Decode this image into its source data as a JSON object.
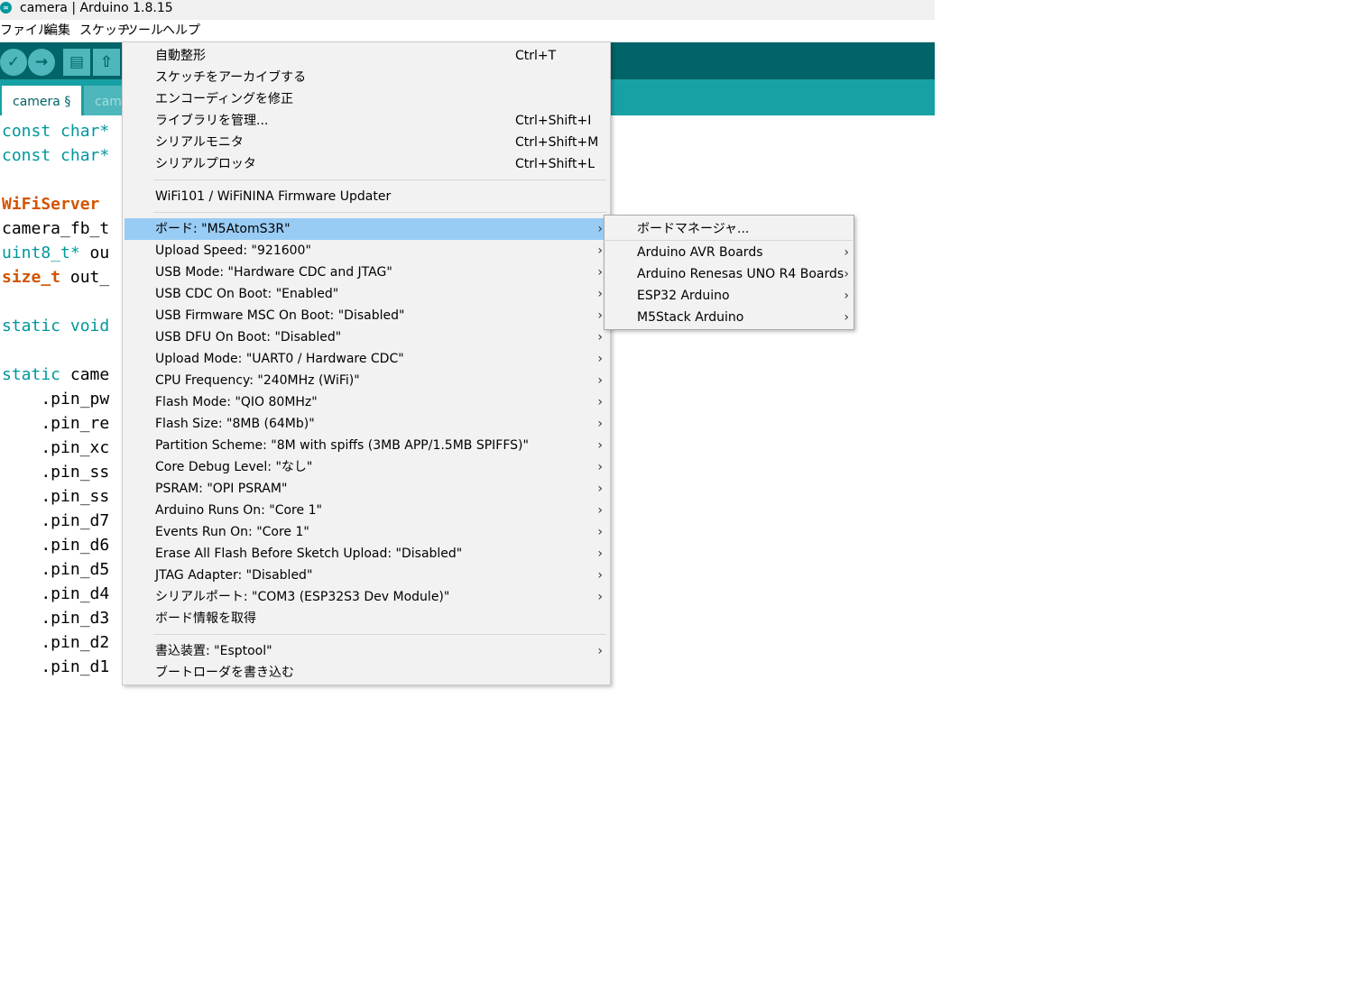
{
  "window": {
    "title": "camera | Arduino 1.8.15",
    "app_icon": "arduino-infinity-icon",
    "app_icon_glyph": "∞"
  },
  "menubar": [
    "ファイル",
    "編集",
    "スケッチ",
    "ツール",
    "ヘルプ"
  ],
  "toolbar": {
    "verify_icon": "✓",
    "upload_icon": "→",
    "new_icon": "▤",
    "open_icon": "⇧"
  },
  "tabs": [
    "camera §",
    "cam"
  ],
  "code": [
    {
      "parts": [
        {
          "t": "const char*",
          "c": "kw"
        }
      ]
    },
    {
      "parts": [
        {
          "t": "const char*",
          "c": "kw"
        }
      ]
    },
    {
      "parts": []
    },
    {
      "parts": [
        {
          "t": "WiFiServer",
          "c": "type"
        }
      ]
    },
    {
      "parts": [
        {
          "t": "camera_fb_t",
          "c": "plain"
        }
      ]
    },
    {
      "parts": [
        {
          "t": "uint8_t*",
          "c": "kw"
        },
        {
          "t": " ou",
          "c": "plain"
        }
      ]
    },
    {
      "parts": [
        {
          "t": "size_t",
          "c": "type"
        },
        {
          "t": " out_",
          "c": "plain"
        }
      ]
    },
    {
      "parts": []
    },
    {
      "parts": [
        {
          "t": "static void",
          "c": "kw"
        }
      ]
    },
    {
      "parts": []
    },
    {
      "parts": [
        {
          "t": "static",
          "c": "kw"
        },
        {
          "t": " came",
          "c": "plain"
        }
      ]
    },
    {
      "parts": [
        {
          "t": "    .pin_pw",
          "c": "plain"
        }
      ]
    },
    {
      "parts": [
        {
          "t": "    .pin_re",
          "c": "plain"
        }
      ]
    },
    {
      "parts": [
        {
          "t": "    .pin_xc",
          "c": "plain"
        }
      ]
    },
    {
      "parts": [
        {
          "t": "    .pin_ss",
          "c": "plain"
        }
      ]
    },
    {
      "parts": [
        {
          "t": "    .pin_ss",
          "c": "plain"
        }
      ]
    },
    {
      "parts": [
        {
          "t": "    .pin_d7",
          "c": "plain"
        }
      ]
    },
    {
      "parts": [
        {
          "t": "    .pin_d6",
          "c": "plain"
        }
      ]
    },
    {
      "parts": [
        {
          "t": "    .pin_d5",
          "c": "plain"
        }
      ]
    },
    {
      "parts": [
        {
          "t": "    .pin_d4",
          "c": "plain"
        }
      ]
    },
    {
      "parts": [
        {
          "t": "    .pin_d3",
          "c": "plain"
        }
      ]
    },
    {
      "parts": [
        {
          "t": "    .pin_d2",
          "c": "plain"
        }
      ]
    },
    {
      "parts": [
        {
          "t": "    .pin_d1",
          "c": "plain"
        }
      ]
    }
  ],
  "tools_menu": [
    {
      "label": "自動整形",
      "shortcut": "Ctrl+T"
    },
    {
      "label": "スケッチをアーカイブする"
    },
    {
      "label": "エンコーディングを修正"
    },
    {
      "label": "ライブラリを管理...",
      "shortcut": "Ctrl+Shift+I"
    },
    {
      "label": "シリアルモニタ",
      "shortcut": "Ctrl+Shift+M"
    },
    {
      "label": "シリアルプロッタ",
      "shortcut": "Ctrl+Shift+L"
    },
    {
      "separator": true
    },
    {
      "label": "WiFi101 / WiFiNINA Firmware Updater"
    },
    {
      "separator": true
    },
    {
      "label": "ボード: \"M5AtomS3R\"",
      "submenu": true,
      "highlighted": true
    },
    {
      "label": "Upload Speed: \"921600\"",
      "submenu": true
    },
    {
      "label": "USB Mode: \"Hardware CDC and JTAG\"",
      "submenu": true
    },
    {
      "label": "USB CDC On Boot: \"Enabled\"",
      "submenu": true
    },
    {
      "label": "USB Firmware MSC On Boot: \"Disabled\"",
      "submenu": true
    },
    {
      "label": "USB DFU On Boot: \"Disabled\"",
      "submenu": true
    },
    {
      "label": "Upload Mode: \"UART0 / Hardware CDC\"",
      "submenu": true
    },
    {
      "label": "CPU Frequency: \"240MHz (WiFi)\"",
      "submenu": true
    },
    {
      "label": "Flash Mode: \"QIO 80MHz\"",
      "submenu": true
    },
    {
      "label": "Flash Size: \"8MB (64Mb)\"",
      "submenu": true
    },
    {
      "label": "Partition Scheme: \"8M with spiffs (3MB APP/1.5MB SPIFFS)\"",
      "submenu": true
    },
    {
      "label": "Core Debug Level: \"なし\"",
      "submenu": true
    },
    {
      "label": "PSRAM: \"OPI PSRAM\"",
      "submenu": true
    },
    {
      "label": "Arduino Runs On: \"Core 1\"",
      "submenu": true
    },
    {
      "label": "Events Run On: \"Core 1\"",
      "submenu": true
    },
    {
      "label": "Erase All Flash Before Sketch Upload: \"Disabled\"",
      "submenu": true
    },
    {
      "label": "JTAG Adapter: \"Disabled\"",
      "submenu": true
    },
    {
      "label": "シリアルポート: \"COM3 (ESP32S3 Dev Module)\"",
      "submenu": true
    },
    {
      "label": "ボード情報を取得"
    },
    {
      "separator": true
    },
    {
      "label": "書込装置: \"Esptool\"",
      "submenu": true
    },
    {
      "label": "ブートローダを書き込む"
    }
  ],
  "board_submenu": [
    {
      "label": "ボードマネージャ..."
    },
    {
      "label": "Arduino AVR Boards",
      "submenu": true
    },
    {
      "label": "Arduino Renesas UNO R4 Boards",
      "submenu": true
    },
    {
      "label": "ESP32 Arduino",
      "submenu": true
    },
    {
      "label": "M5Stack Arduino",
      "submenu": true
    }
  ],
  "submenu_arrow": "›",
  "colors": {
    "toolbar": "#006468",
    "tabbar": "#17a1a5",
    "button": "#4db7bb",
    "keyword": "#00979c",
    "type": "#d35400",
    "menu_bg": "#f2f2f2",
    "menu_highlight": "#99ccf5"
  }
}
